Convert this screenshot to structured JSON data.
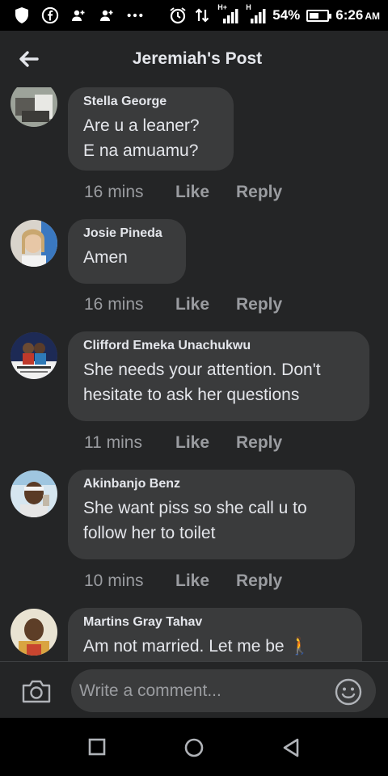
{
  "status_bar": {
    "battery_percent": "54%",
    "battery_level": 0.54,
    "time": "6:26",
    "ampm": "AM",
    "network_label_1": "H+",
    "network_label_2": "H",
    "icons": [
      "shield-icon",
      "facebook-icon",
      "add-person-icon",
      "add-person-icon",
      "more-dots-icon",
      "alarm-icon",
      "data-transfer-icon",
      "signal-icon",
      "signal-icon",
      "battery-icon"
    ]
  },
  "header": {
    "title": "Jeremiah's Post",
    "back_icon": "arrow-left-icon"
  },
  "comments": [
    {
      "name": "Stella George",
      "text": "Are u a leaner?\nE na amuamu?",
      "time": "16 mins",
      "like": "Like",
      "reply": "Reply"
    },
    {
      "name": "Josie Pineda",
      "text": "Amen",
      "time": "16 mins",
      "like": "Like",
      "reply": "Reply"
    },
    {
      "name": "Clifford Emeka Unachukwu",
      "text": "She needs your attention. Don't\nhesitate to ask her questions",
      "time": "11 mins",
      "like": "Like",
      "reply": "Reply"
    },
    {
      "name": "Akinbanjo Benz",
      "text": "She want piss so she call u to\nfollow her to toilet",
      "time": "10 mins",
      "like": "Like",
      "reply": "Reply"
    },
    {
      "name": "Martins Gray Tahav",
      "text": "Am not married. Let me be 🚶",
      "time": "",
      "like": "",
      "reply": ""
    }
  ],
  "composer": {
    "placeholder": "Write a comment...",
    "camera_icon": "camera-icon",
    "emoji_icon": "emoji-icon"
  },
  "nav_bar": {
    "icons": [
      "recent-apps-icon",
      "home-icon",
      "back-triangle-icon"
    ]
  },
  "colors": {
    "background": "#242526",
    "bubble": "#3a3b3c",
    "text_primary": "#e4e6eb",
    "text_secondary": "#9a9ca0"
  }
}
